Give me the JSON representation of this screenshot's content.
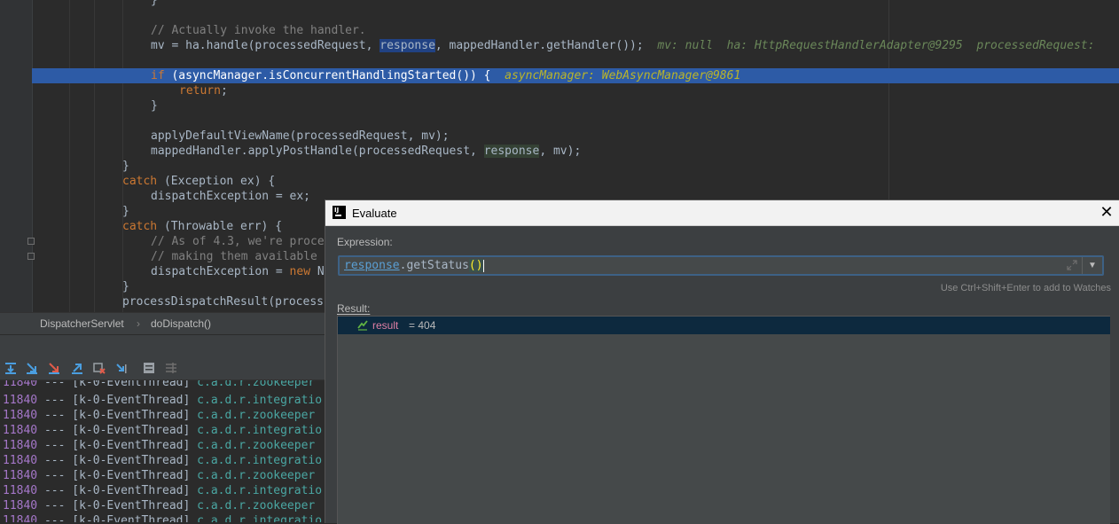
{
  "editor": {
    "lines": [
      {
        "text": "}"
      },
      {
        "text": "// Actually invoke the handler."
      },
      {
        "mv": "mv = ha.handle(processedRequest, ",
        "response": "response",
        "rest": ", mappedHandler.getHandler());",
        "inline": "mv: null  ha: HttpRequestHandlerAdapter@9295  processedRequest:"
      },
      {
        "kw": "if",
        "code": " (asyncManager.isConcurrentHandlingStarted()) {",
        "inline": "asyncManager: WebAsyncManager@9861"
      },
      {
        "kw": "return",
        "code": ";"
      },
      {
        "text": "}"
      },
      {
        "text": "applyDefaultViewName(processedRequest, mv);"
      },
      {
        "pre": "mappedHandler.applyPostHandle(processedRequest, ",
        "response": "response",
        "post": ", mv);"
      },
      {
        "text": "}"
      },
      {
        "kw": "catch",
        "code": " (Exception ex) {"
      },
      {
        "text": "dispatchException = ex;"
      },
      {
        "text": "}"
      },
      {
        "kw": "catch",
        "code": " (Throwable err) {"
      },
      {
        "text": "// As of 4.3, we're proce"
      },
      {
        "text": "// making them available "
      },
      {
        "pre": "dispatchException = ",
        "kw": "new",
        "post": " N"
      },
      {
        "text": "}"
      },
      {
        "text": "processDispatchResult(process"
      }
    ]
  },
  "breadcrumb": {
    "class_name": "DispatcherServlet",
    "separator": "›",
    "method_name": "doDispatch()"
  },
  "console": {
    "lines": [
      {
        "pid": "11840",
        "sep": " --- ",
        "thread": "[k-0-EventThread]",
        "logger": "c.a.d.r.zookeeper"
      },
      {
        "pid": "11840",
        "sep": " --- ",
        "thread": "[k-0-EventThread]",
        "logger": "c.a.d.r.integratio"
      },
      {
        "pid": "11840",
        "sep": " --- ",
        "thread": "[k-0-EventThread]",
        "logger": "c.a.d.r.zookeeper"
      },
      {
        "pid": "11840",
        "sep": " --- ",
        "thread": "[k-0-EventThread]",
        "logger": "c.a.d.r.integratio"
      },
      {
        "pid": "11840",
        "sep": " --- ",
        "thread": "[k-0-EventThread]",
        "logger": "c.a.d.r.zookeeper"
      },
      {
        "pid": "11840",
        "sep": " --- ",
        "thread": "[k-0-EventThread]",
        "logger": "c.a.d.r.integratio"
      },
      {
        "pid": "11840",
        "sep": " --- ",
        "thread": "[k-0-EventThread]",
        "logger": "c.a.d.r.zookeeper"
      },
      {
        "pid": "11840",
        "sep": " --- ",
        "thread": "[k-0-EventThread]",
        "logger": "c.a.d.r.integratio"
      },
      {
        "pid": "11840",
        "sep": " --- ",
        "thread": "[k-0-EventThread]",
        "logger": "c.a.d.r.zookeeper"
      },
      {
        "pid": "11840",
        "sep": " --- ",
        "thread": "[k-0-EventThread]",
        "logger": "c.a.d.r.integratio"
      }
    ]
  },
  "dialog": {
    "title": "Evaluate",
    "close_glyph": "✕",
    "expression_label": "Expression:",
    "expression": {
      "var": "response",
      "method": ".getStatus",
      "parens": "()"
    },
    "dropdown_glyph": "▼",
    "hint": "Use Ctrl+Shift+Enter to add to Watches",
    "result_label": "Result:",
    "result": {
      "name": "result",
      "value": " = 404"
    }
  },
  "colors": {
    "editor_bg": "#2b2b2b",
    "selected_line": "#2d5ba6",
    "keyword": "#cc7832",
    "inline_value": "#bbb529",
    "console_pid": "#a577c9",
    "console_logger": "#4aa7a3",
    "result_selection": "#0d293e"
  }
}
